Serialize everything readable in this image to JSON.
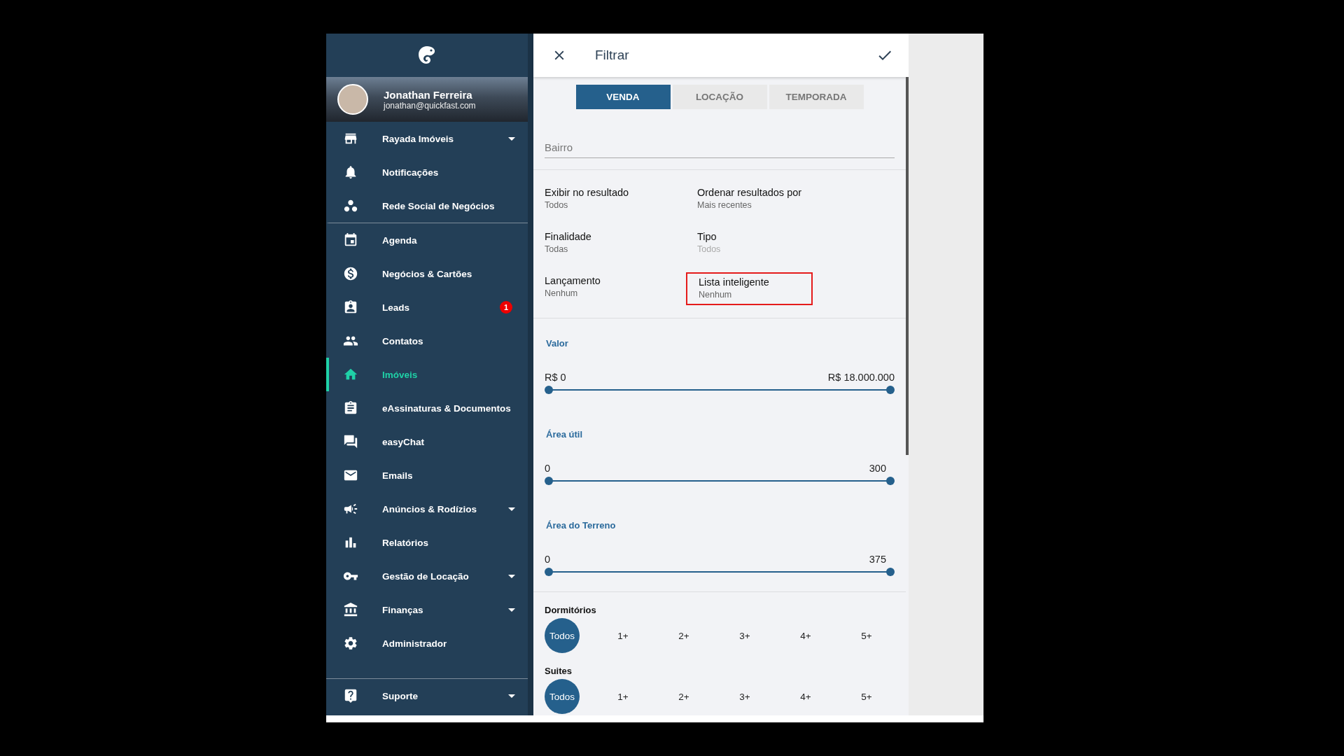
{
  "sidebar": {
    "user": {
      "name": "Jonathan Ferreira",
      "email": "jonathan@quickfast.com"
    },
    "items": [
      {
        "label": "Rayada Imóveis",
        "selected": false,
        "has_submenu": true,
        "divider_after": false
      },
      {
        "label": "Notificações",
        "selected": false,
        "has_submenu": false,
        "divider_after": false
      },
      {
        "label": "Rede Social de Negócios",
        "selected": false,
        "has_submenu": false,
        "divider_after": true
      },
      {
        "label": "Agenda",
        "selected": false,
        "has_submenu": false,
        "divider_after": false
      },
      {
        "label": "Negócios & Cartões",
        "selected": false,
        "has_submenu": false,
        "divider_after": false
      },
      {
        "label": "Leads",
        "selected": false,
        "has_submenu": false,
        "divider_after": false,
        "badge": "1"
      },
      {
        "label": "Contatos",
        "selected": false,
        "has_submenu": false,
        "divider_after": false
      },
      {
        "label": "Imóveis",
        "selected": true,
        "has_submenu": false,
        "divider_after": false
      },
      {
        "label": "eAssinaturas & Documentos",
        "selected": false,
        "has_submenu": false,
        "divider_after": false
      },
      {
        "label": "easyChat",
        "selected": false,
        "has_submenu": false,
        "divider_after": false
      },
      {
        "label": "Emails",
        "selected": false,
        "has_submenu": false,
        "divider_after": false
      },
      {
        "label": "Anúncios & Rodízios",
        "selected": false,
        "has_submenu": true,
        "divider_after": false
      },
      {
        "label": "Relatórios",
        "selected": false,
        "has_submenu": false,
        "divider_after": false
      },
      {
        "label": "Gestão de Locação",
        "selected": false,
        "has_submenu": true,
        "divider_after": false
      },
      {
        "label": "Finanças",
        "selected": false,
        "has_submenu": true,
        "divider_after": false
      },
      {
        "label": "Administrador",
        "selected": false,
        "has_submenu": false,
        "divider_after": false
      }
    ],
    "footer_item": {
      "label": "Suporte",
      "has_submenu": true
    }
  },
  "filter": {
    "title": "Filtrar",
    "tabs": [
      {
        "label": "VENDA",
        "selected": true
      },
      {
        "label": "LOCAÇÃO",
        "selected": false
      },
      {
        "label": "TEMPORADA",
        "selected": false
      }
    ],
    "search": {
      "placeholder": "Bairro"
    },
    "fields": [
      {
        "label": "Exibir no resultado",
        "value": "Todos",
        "disabled": false,
        "highlighted": false
      },
      {
        "label": "Ordenar resultados por",
        "value": "Mais recentes",
        "disabled": false,
        "highlighted": false
      },
      {
        "label": "Finalidade",
        "value": "Todas",
        "disabled": false,
        "highlighted": false
      },
      {
        "label": "Tipo",
        "value": "Todos",
        "disabled": true,
        "highlighted": false
      },
      {
        "label": "Lançamento",
        "value": "Nenhum",
        "disabled": false,
        "highlighted": false
      },
      {
        "label": "Lista inteligente",
        "value": "Nenhum",
        "disabled": false,
        "highlighted": true
      }
    ],
    "ranges": [
      {
        "label": "Valor",
        "min": "R$ 0",
        "max": "R$ 18.000.000",
        "level": 1
      },
      {
        "label": "Área útil",
        "min": "0",
        "max": "300",
        "level": 1
      },
      {
        "label": "Área do Terreno",
        "min": "0",
        "max": "375",
        "level": 1
      }
    ],
    "choices": [
      {
        "label": "Dormitórios",
        "options": [
          {
            "label": "Todos",
            "selected": true
          },
          {
            "label": "1+",
            "selected": false
          },
          {
            "label": "2+",
            "selected": false
          },
          {
            "label": "3+",
            "selected": false
          },
          {
            "label": "4+",
            "selected": false
          },
          {
            "label": "5+",
            "selected": false
          }
        ]
      },
      {
        "label": "Suites",
        "options": [
          {
            "label": "Todos",
            "selected": true
          },
          {
            "label": "1+",
            "selected": false
          },
          {
            "label": "2+",
            "selected": false
          },
          {
            "label": "3+",
            "selected": false
          },
          {
            "label": "4+",
            "selected": false
          },
          {
            "label": "5+",
            "selected": false
          }
        ]
      }
    ]
  }
}
